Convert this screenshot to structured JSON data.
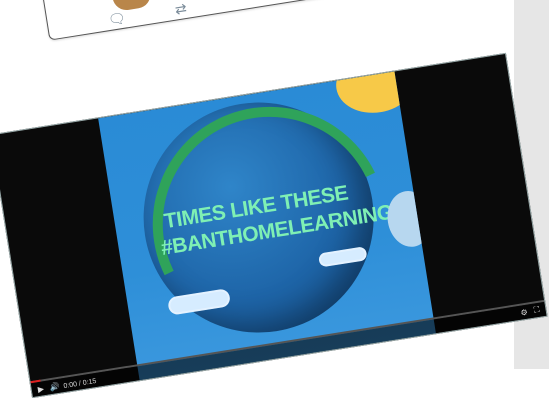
{
  "tweet": {
    "reply_icon": "reply-icon",
    "retweet_icon": "retweet-icon"
  },
  "video": {
    "overlay_text_line1": "TIMES LIKE THESE",
    "overlay_text_line2": "#BANTHOMELEARNING",
    "time_display": "0:00 / 0:15",
    "progress": 0.02,
    "colors": {
      "sky": "#2e8fd8",
      "globe": "#1e65a8",
      "text": "#7ff0b4",
      "sun": "#f7c948",
      "land": "#2fa35a"
    }
  }
}
